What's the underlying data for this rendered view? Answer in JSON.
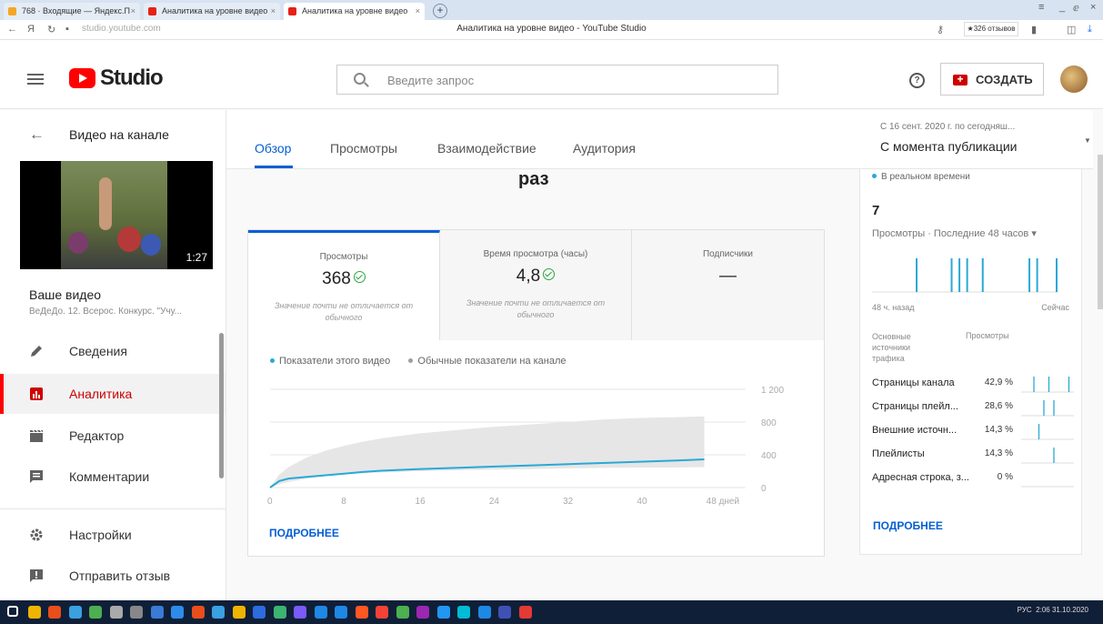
{
  "browser": {
    "tabs": [
      {
        "title": "768 · Входящие — Яндекс.П",
        "color": "#f5a623"
      },
      {
        "title": "Аналитика на уровне видео",
        "color": "#e62117"
      },
      {
        "title": "Аналитика на уровне видео",
        "color": "#e62117"
      }
    ],
    "url": "studio.youtube.com",
    "page_title": "Аналитика на уровне видео - YouTube Studio",
    "reviews": "★326 отзывов"
  },
  "header": {
    "logo_text": "Studio",
    "search_placeholder": "Введите запрос",
    "create_label": "СОЗДАТЬ",
    "help_glyph": "?"
  },
  "sidebar": {
    "back_title": "Видео на канале",
    "duration": "1:27",
    "your_video": "Ваше видео",
    "video_subtitle": "ВеДеДо. 12. Всерос. Конкурс. \"Учу...",
    "items": [
      {
        "label": "Сведения",
        "icon": "pencil-icon",
        "active": false
      },
      {
        "label": "Аналитика",
        "icon": "analytics-icon",
        "active": true
      },
      {
        "label": "Редактор",
        "icon": "clapperboard-icon",
        "active": false
      },
      {
        "label": "Комментарии",
        "icon": "comment-icon",
        "active": false
      },
      {
        "label": "Настройки",
        "icon": "gear-icon",
        "active": false
      },
      {
        "label": "Отправить отзыв",
        "icon": "feedback-icon",
        "active": false
      }
    ]
  },
  "tabs": [
    "Обзор",
    "Просмотры",
    "Взаимодействие",
    "Аудитория"
  ],
  "date_range": {
    "small": "С 16 сент. 2020 г. по сегодняш...",
    "main": "С момента публикации"
  },
  "overview": {
    "headline_tail": "раз",
    "metrics": [
      {
        "label": "Просмотры",
        "value": "368",
        "note": "Значение почти не отличается от обычного",
        "check": true
      },
      {
        "label": "Время просмотра (часы)",
        "value": "4,8",
        "note": "Значение почти не отличается от обычного",
        "check": true
      },
      {
        "label": "Подписчики",
        "value": "—",
        "note": "",
        "check": false
      }
    ],
    "legend": {
      "this_video": "Показатели этого видео",
      "typical": "Обычные показатели на канале"
    },
    "more": "ПОДРОБНЕЕ"
  },
  "chart_data": [
    {
      "type": "line",
      "title": "",
      "x_ticks": [
        "0",
        "8",
        "16",
        "24",
        "32",
        "40",
        "48 дней"
      ],
      "y_ticks": [
        "0",
        "400",
        "800",
        "1 200"
      ],
      "ylim": [
        0,
        1200
      ],
      "xlim": [
        0,
        50
      ],
      "series": [
        {
          "name": "Показатели этого видео",
          "color": "#29a9d6",
          "x": [
            0,
            1,
            2,
            4,
            6,
            8,
            10,
            12,
            14,
            16,
            20,
            24,
            28,
            32,
            36,
            40,
            44,
            47
          ],
          "y": [
            0,
            80,
            110,
            130,
            150,
            170,
            190,
            205,
            215,
            225,
            240,
            255,
            270,
            285,
            300,
            315,
            330,
            345
          ]
        },
        {
          "name": "Обычные показатели на канале",
          "color": "#9e9e9e",
          "kind": "band",
          "x": [
            0,
            1,
            2,
            4,
            6,
            8,
            10,
            12,
            16,
            20,
            24,
            28,
            32,
            36,
            40,
            44,
            47
          ],
          "low": [
            0,
            40,
            70,
            110,
            140,
            160,
            175,
            185,
            200,
            210,
            220,
            225,
            235,
            240,
            245,
            245,
            250
          ],
          "high": [
            0,
            160,
            250,
            370,
            450,
            510,
            560,
            600,
            660,
            700,
            740,
            770,
            800,
            830,
            850,
            860,
            870
          ]
        }
      ]
    },
    {
      "type": "bar",
      "title": "Просмотры · Последние 48 часов",
      "x_labels": [
        "48 ч. назад",
        "Сейчас"
      ],
      "values": [
        0,
        0,
        0,
        0,
        0,
        0,
        0,
        0,
        0,
        0,
        0,
        1,
        0,
        0,
        0,
        0,
        0,
        0,
        0,
        0,
        1,
        0,
        1,
        0,
        1,
        0,
        0,
        0,
        1,
        0,
        0,
        0,
        0,
        0,
        0,
        0,
        0,
        0,
        0,
        0,
        1,
        0,
        1,
        0,
        0,
        0,
        0,
        1
      ]
    }
  ],
  "realtime": {
    "label": "В реальном времени",
    "count": "7",
    "subtitle": "Просмотры · Последние 48 часов ▾",
    "from": "48 ч. назад",
    "to": "Сейчас",
    "sources_header": "Основные источники трафика",
    "views_header": "Просмотры",
    "sources": [
      {
        "name": "Страницы канала",
        "pct": "42,9 %",
        "spark": [
          0,
          0,
          1,
          0,
          0,
          1,
          0,
          0,
          0,
          1
        ]
      },
      {
        "name": "Страницы плейл...",
        "pct": "28,6 %",
        "spark": [
          0,
          0,
          0,
          0,
          1,
          0,
          1,
          0,
          0,
          0
        ]
      },
      {
        "name": "Внешние источн...",
        "pct": "14,3 %",
        "spark": [
          0,
          0,
          0,
          1,
          0,
          0,
          0,
          0,
          0,
          0
        ]
      },
      {
        "name": "Плейлисты",
        "pct": "14,3 %",
        "spark": [
          0,
          0,
          0,
          0,
          0,
          0,
          1,
          0,
          0,
          0
        ]
      },
      {
        "name": "Адресная строка, з...",
        "pct": "0 %",
        "spark": [
          0,
          0,
          0,
          0,
          0,
          0,
          0,
          0,
          0,
          0
        ]
      }
    ],
    "more": "ПОДРОБНЕЕ"
  },
  "colors": {
    "accent": "#065fd4",
    "brand": "#ff0000",
    "line": "#29a9d6",
    "ok": "#2ba640"
  },
  "taskbar": {
    "clock": "2:06",
    "date": "31.10.2020",
    "lang": "РУС"
  }
}
